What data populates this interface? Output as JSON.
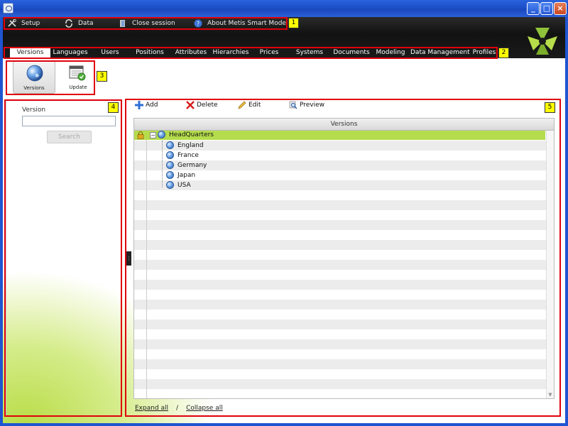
{
  "window": {
    "minimize_label": "_",
    "maximize_label": "□",
    "close_label": "×"
  },
  "top_menu": {
    "setup": "Setup",
    "data": "Data",
    "close_session": "Close session",
    "about": "About Metis Smart Modeling"
  },
  "nav_tabs": [
    "Versions",
    "Languages",
    "Users",
    "Positions",
    "Attributes",
    "Hierarchies",
    "Prices",
    "Systems",
    "Documents",
    "Modeling",
    "Data Management",
    "Profiles"
  ],
  "nav_active": "Versions",
  "toolbar": {
    "versions_label": "Versions",
    "update_label": "Update"
  },
  "search_panel": {
    "version_label": "Version",
    "version_value": "",
    "search_button": "Search",
    "splitter_glyph": "⋮"
  },
  "actions": {
    "add": "Add",
    "delete": "Delete",
    "edit": "Edit",
    "preview": "Preview"
  },
  "grid": {
    "column_header": "Versions",
    "expander_glyph": "−",
    "scroll_down_glyph": "▼",
    "root": "HeadQuarters",
    "children": [
      "England",
      "France",
      "Germany",
      "Japan",
      "USA"
    ]
  },
  "footer": {
    "expand_all": "Expand all",
    "separator": "/",
    "collapse_all": "Collapse all"
  },
  "annotations": [
    "1",
    "2",
    "3",
    "4",
    "5"
  ],
  "colors": {
    "header_bg": "#161616",
    "selected_row": "#b5dc4c",
    "annotation_red": "#e0000b",
    "tag_yellow": "#ffff00"
  }
}
